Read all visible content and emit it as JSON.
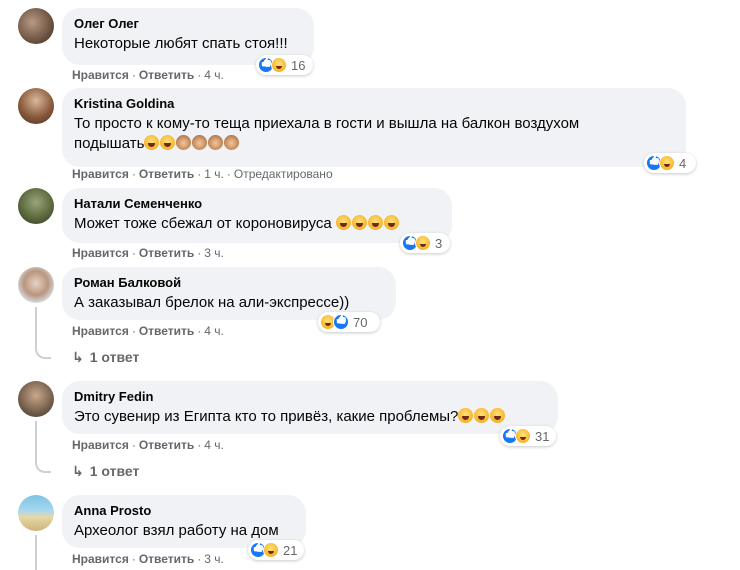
{
  "comments": [
    {
      "author": "Олег Олег",
      "text": "Некоторые любят спать стоя!!!",
      "emojis": [],
      "reaction_count": "16",
      "like_label": "Нравится",
      "reply_label": "Ответить",
      "time": "4 ч.",
      "edited": ""
    },
    {
      "author": "Kristina Goldina",
      "text_line1": "То просто к кому-то теща приехала в гости и вышла на балкон воздухом",
      "text_line2": "подышать",
      "emojis": [
        "laugh",
        "laugh",
        "monkey",
        "monkey",
        "monkey",
        "monkey"
      ],
      "reaction_count": "4",
      "like_label": "Нравится",
      "reply_label": "Ответить",
      "time": "1 ч.",
      "edited": "Отредактировано"
    },
    {
      "author": "Натали Семенченко",
      "text": "Может тоже сбежал от короновируса",
      "emojis": [
        "laugh",
        "laugh",
        "laugh",
        "laugh"
      ],
      "reaction_count": "3",
      "like_label": "Нравится",
      "reply_label": "Ответить",
      "time": "3 ч.",
      "edited": ""
    },
    {
      "author": "Роман Балковой",
      "text": "А заказывал брелок на али-экспрессе))",
      "emojis": [],
      "reaction_count": "70",
      "like_label": "Нравится",
      "reply_label": "Ответить",
      "time": "4 ч.",
      "edited": "",
      "replies_label": "1 ответ"
    },
    {
      "author": "Dmitry Fedin",
      "text": "Это сувенир из Египта кто то привёз, какие проблемы?",
      "emojis": [
        "laugh",
        "laugh",
        "laugh"
      ],
      "reaction_count": "31",
      "like_label": "Нравится",
      "reply_label": "Ответить",
      "time": "4 ч.",
      "edited": "",
      "replies_label": "1 ответ"
    },
    {
      "author": "Anna Prosto",
      "text": "Археолог взял работу на дом",
      "emojis": [],
      "reaction_count": "21",
      "like_label": "Нравится",
      "reply_label": "Ответить",
      "time": "3 ч.",
      "edited": ""
    }
  ],
  "colors": {
    "bubble": "#f0f2f5",
    "meta_text": "#65676b",
    "like_blue": "#1877f2",
    "haha_yellow": "#f7b125"
  },
  "icons": {
    "like": "like-reaction-icon",
    "haha": "haha-reaction-icon",
    "reply_arrow": "reply-arrow-icon"
  }
}
